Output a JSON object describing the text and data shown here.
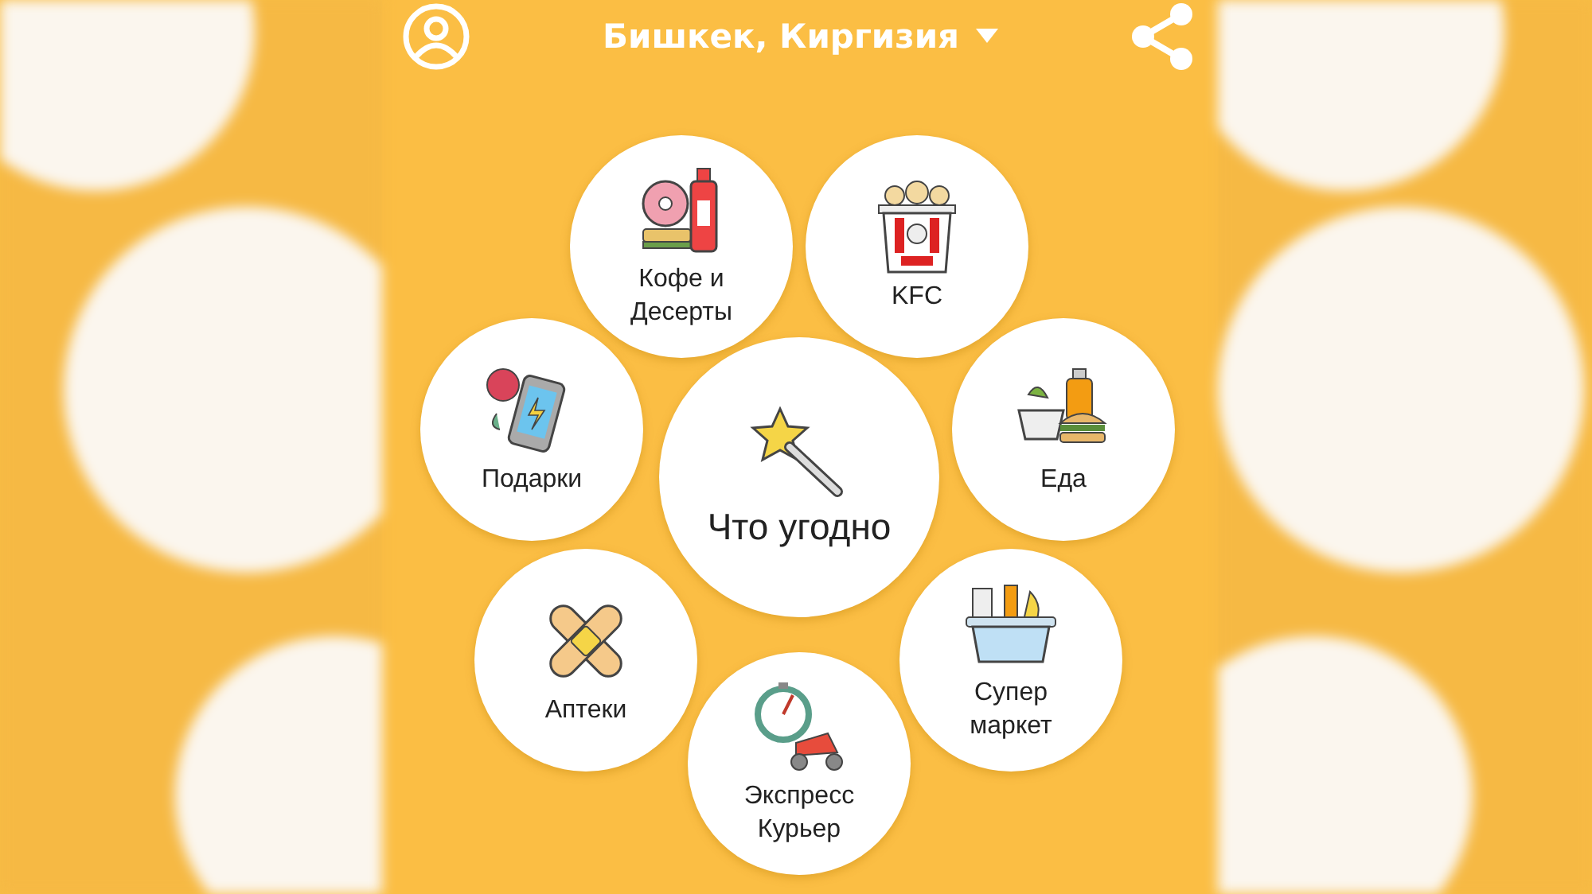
{
  "header": {
    "city": "Бишкек, Киргизия"
  },
  "categories": [
    {
      "kind": "desserts",
      "label": "Кофе и Десерты"
    },
    {
      "kind": "kfc",
      "label": "KFC"
    },
    {
      "kind": "gifts",
      "label": "Подарки"
    },
    {
      "kind": "anything",
      "label": "Что угодно"
    },
    {
      "kind": "food",
      "label": "Еда"
    },
    {
      "kind": "pharmacy",
      "label": "Аптеки"
    },
    {
      "kind": "supermarket",
      "label": "Супер маркет"
    },
    {
      "kind": "courier",
      "label": "Экспресс Курьер"
    }
  ]
}
